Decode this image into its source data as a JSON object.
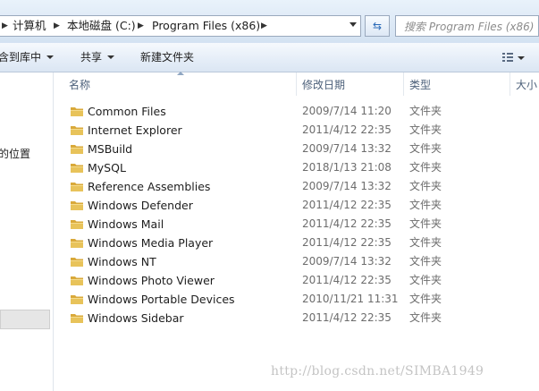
{
  "breadcrumb": {
    "items": [
      "计算机",
      "本地磁盘 (C:)",
      "Program Files (x86)"
    ]
  },
  "search": {
    "placeholder": "搜索 Program Files (x86)"
  },
  "toolbar": {
    "include_library": "含到库中",
    "share": "共享",
    "new_folder": "新建文件夹"
  },
  "nav": {
    "location_label": "的位置"
  },
  "columns": {
    "name": "名称",
    "modified": "修改日期",
    "type": "类型",
    "size": "大小"
  },
  "files": [
    {
      "name": "Common Files",
      "modified": "2009/7/14 11:20",
      "type": "文件夹"
    },
    {
      "name": "Internet Explorer",
      "modified": "2011/4/12 22:35",
      "type": "文件夹"
    },
    {
      "name": "MSBuild",
      "modified": "2009/7/14 13:32",
      "type": "文件夹"
    },
    {
      "name": "MySQL",
      "modified": "2018/1/13 21:08",
      "type": "文件夹"
    },
    {
      "name": "Reference Assemblies",
      "modified": "2009/7/14 13:32",
      "type": "文件夹"
    },
    {
      "name": "Windows Defender",
      "modified": "2011/4/12 22:35",
      "type": "文件夹"
    },
    {
      "name": "Windows Mail",
      "modified": "2011/4/12 22:35",
      "type": "文件夹"
    },
    {
      "name": "Windows Media Player",
      "modified": "2011/4/12 22:35",
      "type": "文件夹"
    },
    {
      "name": "Windows NT",
      "modified": "2009/7/14 13:32",
      "type": "文件夹"
    },
    {
      "name": "Windows Photo Viewer",
      "modified": "2011/4/12 22:35",
      "type": "文件夹"
    },
    {
      "name": "Windows Portable Devices",
      "modified": "2010/11/21 11:31",
      "type": "文件夹"
    },
    {
      "name": "Windows Sidebar",
      "modified": "2011/4/12 22:35",
      "type": "文件夹"
    }
  ],
  "watermark": "http://blog.csdn.net/SIMBA1949",
  "icons": {
    "folder": "folder-icon",
    "refresh": "refresh-icon",
    "view": "view-options-icon"
  },
  "colors": {
    "folder_body": "#e8c35a",
    "folder_tab": "#d9a93a",
    "header_text": "#4c607a",
    "secondary_text": "#6d6d6d"
  }
}
